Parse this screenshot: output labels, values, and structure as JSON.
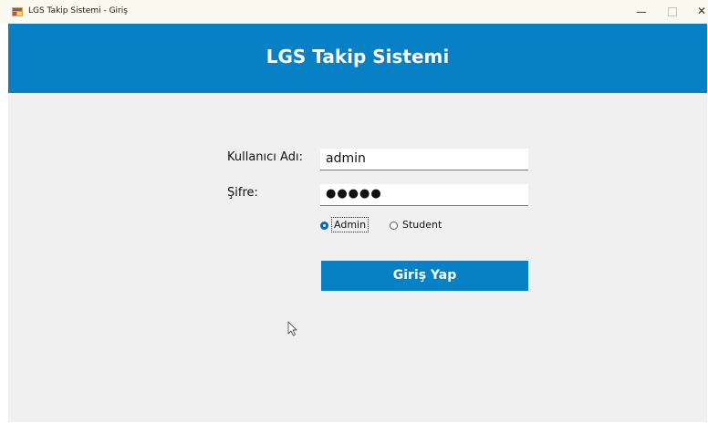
{
  "window": {
    "title": "LGS Takip Sistemi - Giriş",
    "minimize_icon": "minimize-icon",
    "maximize_icon": "maximize-icon",
    "close_glyph": "✕"
  },
  "header": {
    "title": "LGS Takip Sistemi"
  },
  "form": {
    "username_label": "Kullanıcı Adı:",
    "username_value": "admin",
    "password_label": "Şifre:",
    "password_masked": "●●●●●",
    "role_options": [
      {
        "label": "Admin",
        "selected": true
      },
      {
        "label": "Student",
        "selected": false
      }
    ],
    "login_button": "Giriş Yap"
  },
  "colors": {
    "accent": "#0681c5",
    "background": "#f0f0f0"
  }
}
